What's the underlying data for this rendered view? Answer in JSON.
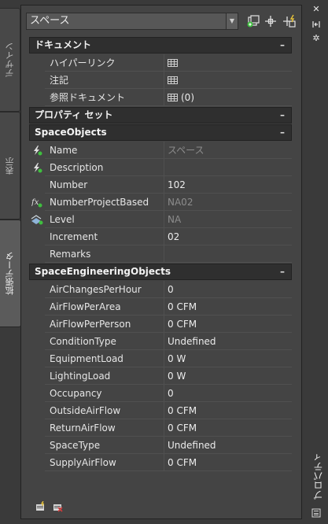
{
  "tabs": [
    {
      "label": "デザイン"
    },
    {
      "label": "表示"
    },
    {
      "label": "拡張データ"
    }
  ],
  "toolbar": {
    "style_select_value": "スペース",
    "icons": [
      "add-style-icon",
      "select-objects-icon",
      "quick-select-icon"
    ]
  },
  "categories": {
    "document": {
      "title": "ドキュメント",
      "collapse": "–",
      "rows": [
        {
          "name": "ハイパーリンク",
          "value": ""
        },
        {
          "name": "注記",
          "value": ""
        },
        {
          "name": "参照ドキュメント",
          "value": "(0)"
        }
      ]
    },
    "property_set": {
      "title": "プロパティ セット",
      "collapse": "–"
    },
    "space_objects": {
      "title": "SpaceObjects",
      "collapse": "–",
      "rows": [
        {
          "name": "Name",
          "value": "スペース"
        },
        {
          "name": "Description",
          "value": ""
        },
        {
          "name": "Number",
          "value": "102"
        },
        {
          "name": "NumberProjectBased",
          "value": "NA02"
        },
        {
          "name": "Level",
          "value": "NA"
        },
        {
          "name": "Increment",
          "value": "02"
        },
        {
          "name": "Remarks",
          "value": ""
        }
      ]
    },
    "space_engineering": {
      "title": "SpaceEngineeringObjects",
      "collapse": "–",
      "rows": [
        {
          "name": "AirChangesPerHour",
          "value": "0"
        },
        {
          "name": "AirFlowPerArea",
          "value": "0 CFM"
        },
        {
          "name": "AirFlowPerPerson",
          "value": "0 CFM"
        },
        {
          "name": "ConditionType",
          "value": "Undefined"
        },
        {
          "name": "EquipmentLoad",
          "value": "0 W"
        },
        {
          "name": "LightingLoad",
          "value": "0 W"
        },
        {
          "name": "Occupancy",
          "value": "0"
        },
        {
          "name": "OutsideAirFlow",
          "value": "0 CFM"
        },
        {
          "name": "ReturnAirFlow",
          "value": "0 CFM"
        },
        {
          "name": "SpaceType",
          "value": "Undefined"
        },
        {
          "name": "SupplyAirFlow",
          "value": "0 CFM"
        }
      ]
    }
  },
  "palette_title": "プロパティ",
  "colors": {
    "accent_green": "#3fbf3f",
    "accent_yellow": "#e8c33a",
    "accent_red": "#d03b3b"
  }
}
